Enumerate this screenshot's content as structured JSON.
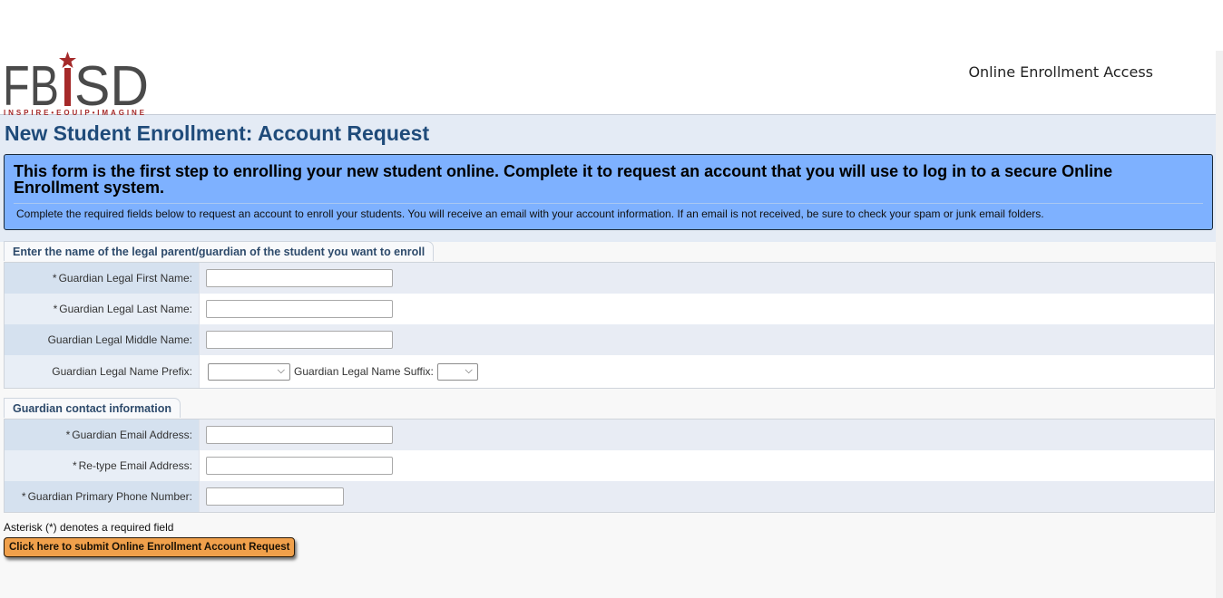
{
  "header": {
    "logo_text": "FBISD",
    "logo_tagline": "INSPIRE•EQUIP•IMAGINE",
    "app_title": "Online Enrollment Access"
  },
  "page_title": "New Student Enrollment: Account Request",
  "info": {
    "headline": "This form is the first step to enrolling your new student online. Complete it to request an account that you will use to log in to a secure Online Enrollment system.",
    "subtext": "Complete the required fields below to request an account to enroll your students. You will receive an email with your account information. If an email is not received, be sure to check your spam or junk email folders."
  },
  "sections": {
    "guardian_name": {
      "tab_label": "Enter the name of the legal parent/guardian of the student you want to enroll",
      "first_name": {
        "required": "*",
        "label": "Guardian Legal First Name:",
        "value": ""
      },
      "last_name": {
        "required": "*",
        "label": "Guardian Legal Last Name:",
        "value": ""
      },
      "middle_name": {
        "label": "Guardian Legal Middle Name:",
        "value": ""
      },
      "prefix": {
        "label": "Guardian Legal Name Prefix:",
        "selected": ""
      },
      "suffix": {
        "label": "Guardian Legal Name Suffix:",
        "selected": ""
      }
    },
    "contact": {
      "tab_label": "Guardian contact information",
      "email": {
        "required": "*",
        "label": "Guardian Email Address:",
        "value": ""
      },
      "email_confirm": {
        "required": "*",
        "label": "Re-type Email Address:",
        "value": ""
      },
      "phone": {
        "required": "*",
        "label": "Guardian Primary Phone Number:",
        "value": ""
      }
    }
  },
  "required_note": "Asterisk (*) denotes a required field",
  "submit_label": "Click here to submit Online Enrollment Account Request",
  "icons": {
    "select_chevron": "⌄"
  },
  "colors": {
    "title": "#1f4b7a",
    "info_box": "#7eb1ff",
    "submit": "#f0a04b",
    "logo_red": "#a52a2a",
    "logo_gray": "#4a4a4a"
  }
}
